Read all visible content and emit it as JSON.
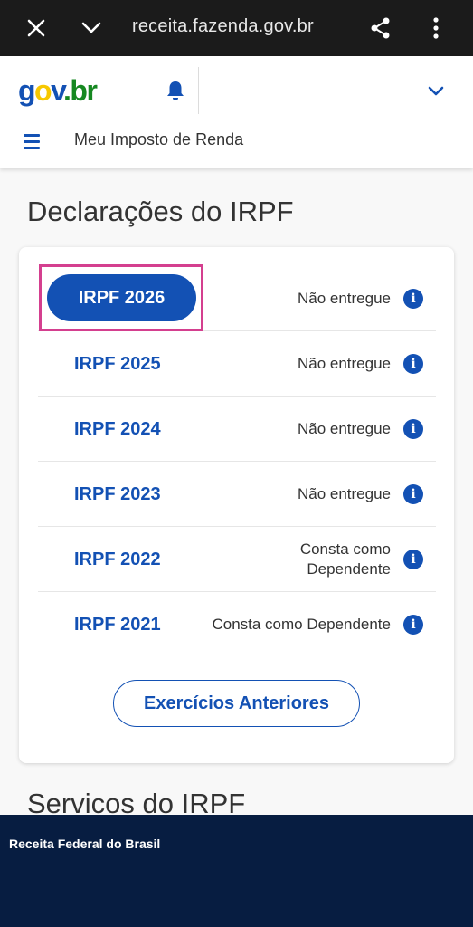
{
  "browser": {
    "url": "receita.fazenda.gov.br",
    "icons": [
      "close-icon",
      "chevron-down-icon",
      "share-icon",
      "more-vert-icon"
    ]
  },
  "header": {
    "logo": {
      "g": "g",
      "o": "o",
      "v": "v",
      "dot": ".",
      "b": "b",
      "r": "r"
    },
    "breadcrumb": "Meu Imposto de Renda",
    "colors": {
      "primary": "#1351b4",
      "logo_yellow": "#f7c800",
      "logo_green": "#168821"
    }
  },
  "main": {
    "title": "Declarações do IRPF",
    "declarations": [
      {
        "year": "IRPF 2026",
        "status": "Não entregue"
      },
      {
        "year": "IRPF 2025",
        "status": "Não entregue"
      },
      {
        "year": "IRPF 2024",
        "status": "Não entregue"
      },
      {
        "year": "IRPF 2023",
        "status": "Não entregue"
      },
      {
        "year": "IRPF 2022",
        "status": "Consta como Dependente"
      },
      {
        "year": "IRPF 2021",
        "status": "Consta como Dependente"
      }
    ],
    "info_glyph": "i",
    "previous_button": "Exercícios Anteriores",
    "section2_title": "Servicos do IRPF"
  },
  "footer": {
    "text": "Receita Federal do Brasil",
    "bg_color": "#071d41"
  }
}
